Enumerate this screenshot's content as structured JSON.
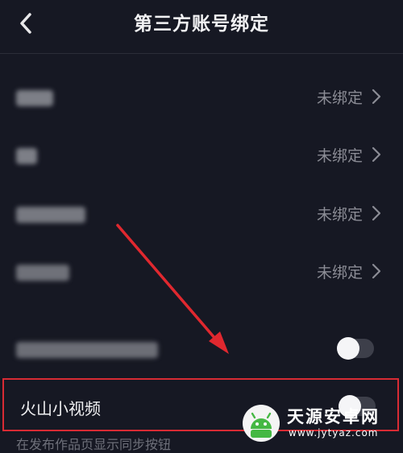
{
  "header": {
    "title": "第三方账号绑定"
  },
  "rows": [
    {
      "status": "未绑定"
    },
    {
      "status": "未绑定"
    },
    {
      "status": "未绑定"
    },
    {
      "status": "未绑定"
    }
  ],
  "toggle_row": {
    "state": "off"
  },
  "highlight_row": {
    "label": "火山小视频",
    "state": "off"
  },
  "footer": {
    "text": "在发布作品页显示同步按钮"
  },
  "annotation": {
    "color": "#d82b34"
  },
  "watermark": {
    "name": "天源安卓网",
    "url": "www.jytyaz.com"
  },
  "colors": {
    "background": "#161823",
    "text": "#e8e8ea",
    "muted": "#8b8c95"
  },
  "icons": {
    "back": "chevron-left-icon",
    "row": "chevron-right-icon",
    "watermark_logo": "android-logo-icon"
  }
}
